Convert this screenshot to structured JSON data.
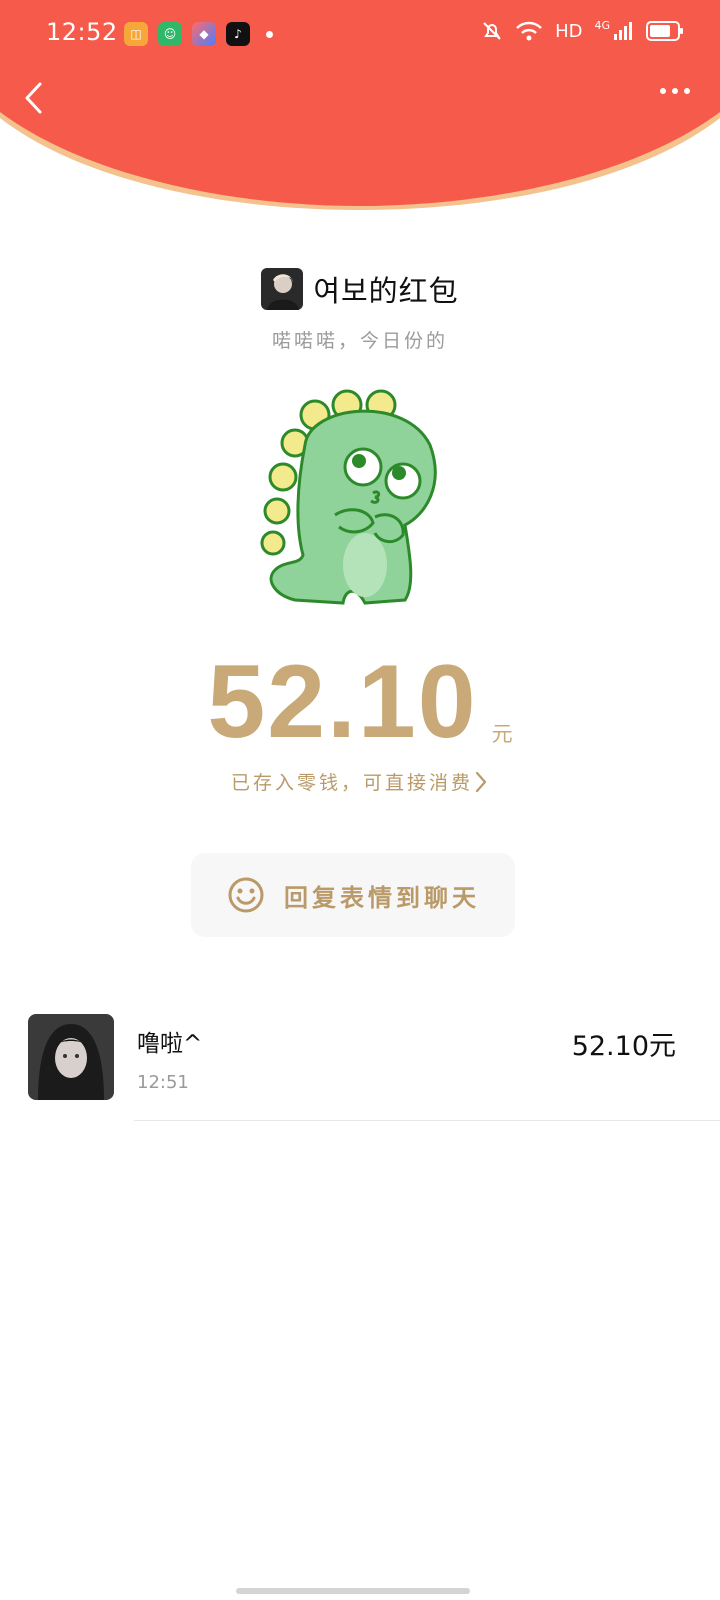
{
  "colors": {
    "header_red": "#f65a4a",
    "gold": "#c9a977",
    "gold_text": "#b99a68",
    "header_edge": "#f3c28d"
  },
  "status_bar": {
    "time": "12:52",
    "network_label": "HD",
    "signal_label": "4G",
    "app_icons": [
      "app-icon-1",
      "app-icon-2",
      "app-icon-3",
      "tiktok-icon"
    ]
  },
  "nav": {
    "back_icon": "chevron-left-icon",
    "more_icon": "more-dots-icon"
  },
  "packet": {
    "sender_name": "여보的红包",
    "greeting": "喏喏喏，今日份的",
    "amount": "52.10",
    "unit": "元",
    "deposit_text": "已存入零钱，可直接消费",
    "reply_label": "回复表情到聊天"
  },
  "receivers": [
    {
      "name": "噜啦^",
      "time": "12:51",
      "amount": "52.10元"
    }
  ]
}
